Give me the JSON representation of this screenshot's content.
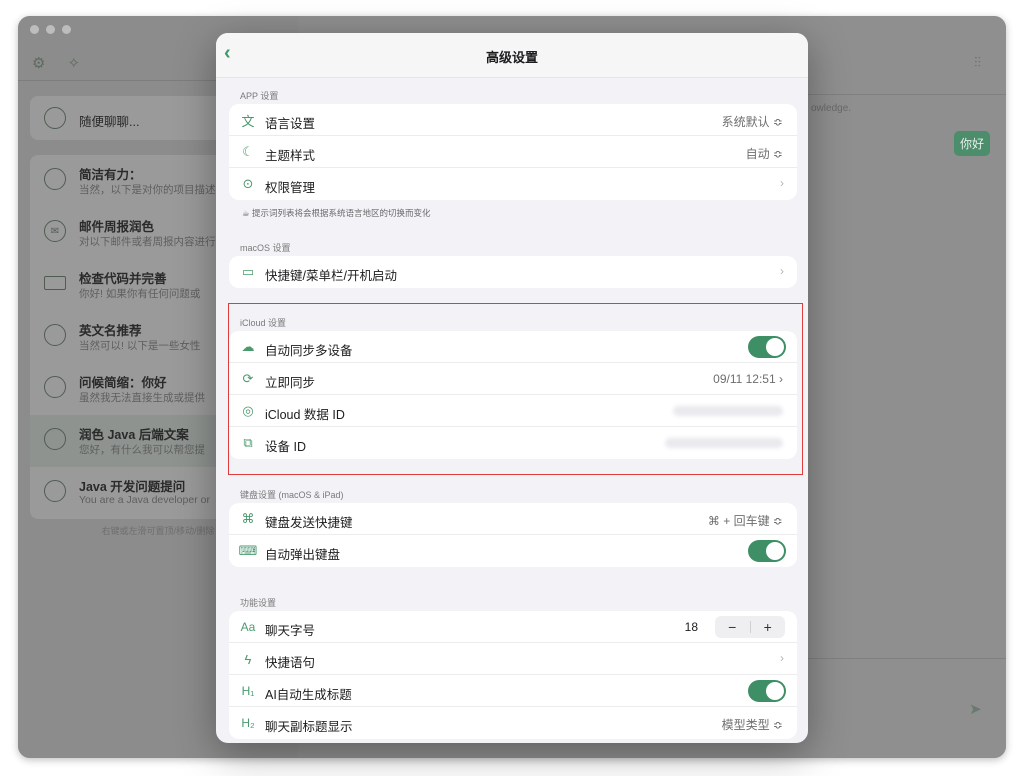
{
  "sidebar": {
    "search_placeholder": "随便聊聊...",
    "chats": [
      {
        "title": "简洁有力：",
        "subtitle": "当然，以下是对你的项目描述"
      },
      {
        "title": "邮件周报润色",
        "subtitle": "对以下邮件或者周报内容进行"
      },
      {
        "title": "检查代码并完善",
        "subtitle": "你好! 如果你有任何问题或"
      },
      {
        "title": "英文名推荐",
        "subtitle": "当然可以! 以下是一些女性"
      },
      {
        "title": "问候简缩：你好",
        "subtitle": "虽然我无法直接生成或提供"
      },
      {
        "title": "润色 Java 后端文案",
        "subtitle": "您好，有什么我可以帮您提"
      },
      {
        "title": "Java 开发问题提问",
        "subtitle": "You are a Java developer or"
      }
    ],
    "hint": "右键或左滑可置顶/移动/删除"
  },
  "main": {
    "knowledge_text": "owledge.",
    "bubble_text": "你好"
  },
  "modal": {
    "title": "高级设置",
    "app_section": {
      "title": "APP 设置",
      "rows": [
        {
          "label": "语言设置",
          "value": "系统默认 ≎"
        },
        {
          "label": "主题样式",
          "value": "自动 ≎"
        },
        {
          "label": "权限管理",
          "value": "›"
        }
      ],
      "hint": "提示词列表将会根据系统语言地区的切换而变化"
    },
    "macos_section": {
      "title": "macOS 设置",
      "rows": [
        {
          "label": "快捷键/菜单栏/开机启动",
          "value": "›"
        }
      ]
    },
    "icloud_section": {
      "title": "iCloud 设置",
      "rows": [
        {
          "label": "自动同步多设备",
          "toggle": true
        },
        {
          "label": "立即同步",
          "value": "09/11 12:51 ›"
        },
        {
          "label": "iCloud 数据 ID"
        },
        {
          "label": "设备 ID"
        }
      ]
    },
    "keyboard_section": {
      "title": "键盘设置 (macOS & iPad)",
      "rows": [
        {
          "label": "键盘发送快捷键",
          "value": "⌘ + 回车键 ≎"
        },
        {
          "label": "自动弹出键盘",
          "toggle": true
        }
      ]
    },
    "feature_section": {
      "title": "功能设置",
      "rows": [
        {
          "label": "聊天字号",
          "value": "18",
          "minus": "−",
          "plus": "+"
        },
        {
          "label": "快捷语句",
          "value": "›"
        },
        {
          "label": "AI自动生成标题",
          "toggle": true
        },
        {
          "label": "聊天副标题显示",
          "value": "模型类型 ≎"
        }
      ]
    }
  },
  "colors": {
    "accent": "#3f8f66",
    "highlight_box": "#e23b3b"
  }
}
